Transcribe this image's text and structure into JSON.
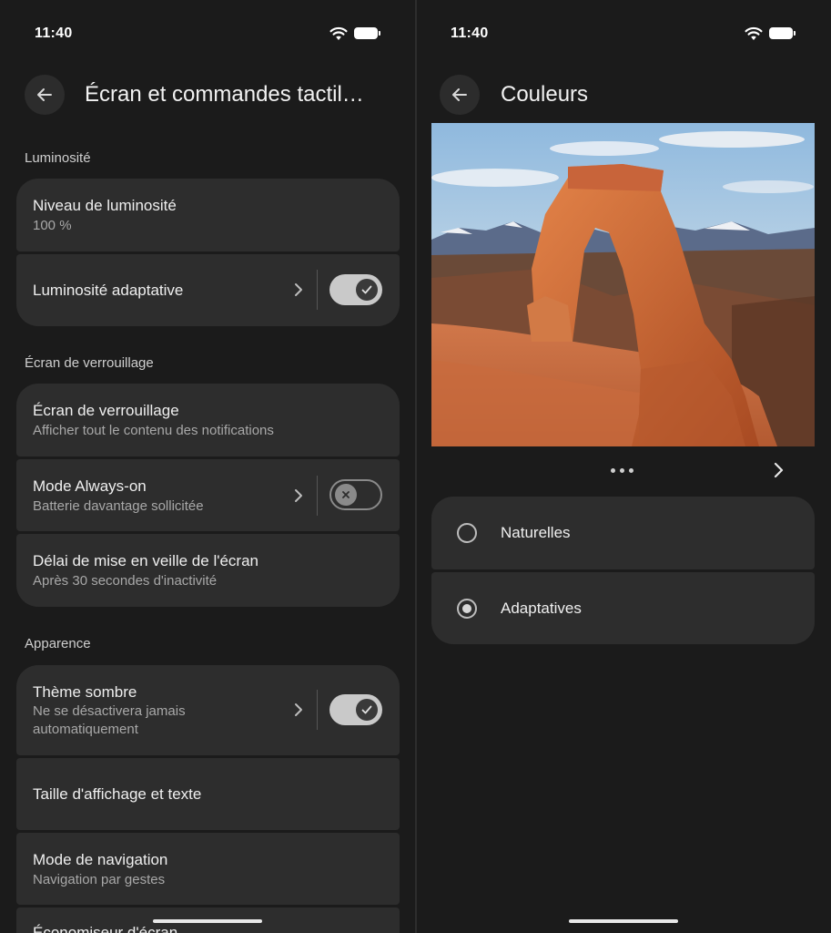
{
  "status_bar": {
    "time": "11:40"
  },
  "left_screen": {
    "title": "Écran et commandes tactil…",
    "sections": {
      "brightness": "Luminosité",
      "lock_screen": "Écran de verrouillage",
      "appearance": "Apparence"
    },
    "items": {
      "brightness_level": {
        "title": "Niveau de luminosité",
        "subtitle": "100 %"
      },
      "adaptive_brightness": {
        "title": "Luminosité adaptative",
        "toggle": true
      },
      "lock_screen": {
        "title": "Écran de verrouillage",
        "subtitle": "Afficher tout le contenu des notifications"
      },
      "always_on": {
        "title": "Mode Always-on",
        "subtitle": "Batterie davantage sollicitée",
        "toggle": false
      },
      "screen_timeout": {
        "title": "Délai de mise en veille de l'écran",
        "subtitle": "Après 30 secondes d'inactivité"
      },
      "dark_theme": {
        "title": "Thème sombre",
        "subtitle": "Ne se désactivera jamais automatiquement",
        "toggle": true
      },
      "display_size": {
        "title": "Taille d'affichage et texte"
      },
      "navigation_mode": {
        "title": "Mode de navigation",
        "subtitle": "Navigation par gestes"
      },
      "screen_saver": {
        "title": "Économiseur d'écran"
      }
    }
  },
  "right_screen": {
    "title": "Couleurs",
    "options": [
      {
        "label": "Naturelles",
        "selected": false
      },
      {
        "label": "Adaptatives",
        "selected": true
      }
    ]
  },
  "colors": {
    "background": "#1b1b1b",
    "card": "#2d2d2d",
    "toggle_on": "#c9c9c9"
  },
  "icons": [
    "back-arrow-icon",
    "chevron-right-icon",
    "check-icon",
    "close-icon",
    "wifi-icon",
    "battery-icon"
  ]
}
